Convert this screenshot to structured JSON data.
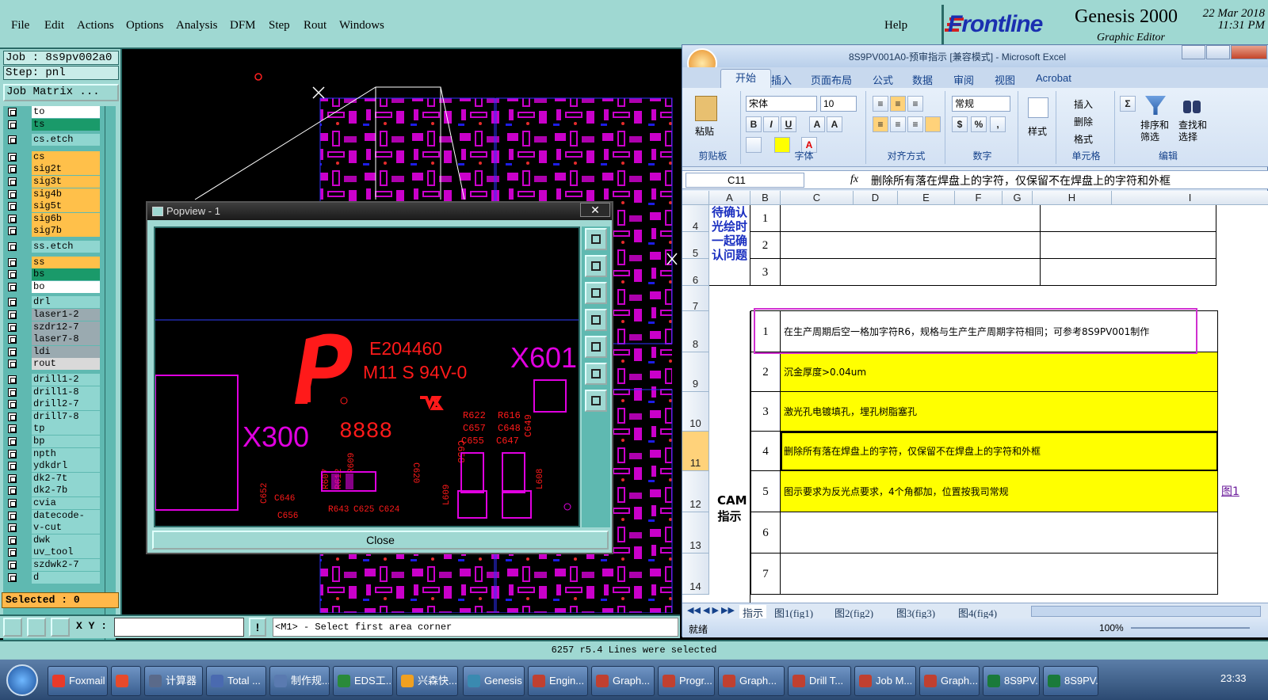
{
  "genesis": {
    "menus": [
      "File",
      "Edit",
      "Actions",
      "Options",
      "Analysis",
      "DFM",
      "Step",
      "Rout",
      "Windows"
    ],
    "help": "Help",
    "brand": "Frontline",
    "product": "Genesis 2000",
    "subtitle": "Graphic Editor",
    "date": "22 Mar 2018",
    "time": "11:31 PM",
    "job": "Job : 8s9pv002a0",
    "step": "Step: pnl",
    "job_matrix": "Job Matrix ...",
    "layers": [
      {
        "name": "to",
        "color": "#ffffff"
      },
      {
        "name": "ts",
        "color": "#1a9a6a"
      },
      {
        "name": "cs.etch",
        "color": "#8fd6d0"
      },
      {
        "name": "cs",
        "color": "#ffc04a"
      },
      {
        "name": "sig2t",
        "color": "#ffc04a"
      },
      {
        "name": "sig3t",
        "color": "#ffc04a"
      },
      {
        "name": "sig4b",
        "color": "#ffc04a"
      },
      {
        "name": "sig5t",
        "color": "#ffc04a"
      },
      {
        "name": "sig6b",
        "color": "#ffc04a"
      },
      {
        "name": "sig7b",
        "color": "#ffc04a"
      },
      {
        "name": "ss.etch",
        "color": "#8fd6d0"
      },
      {
        "name": "ss",
        "color": "#ffc04a"
      },
      {
        "name": "bs",
        "color": "#1a9a6a"
      },
      {
        "name": "bo",
        "color": "#ffffff"
      },
      {
        "name": "drl",
        "color": "#8fd6d0"
      },
      {
        "name": "laser1-2",
        "color": "#9aaab0"
      },
      {
        "name": "szdr12-7",
        "color": "#9aaab0"
      },
      {
        "name": "laser7-8",
        "color": "#9aaab0"
      },
      {
        "name": "ldi",
        "color": "#9aaab0"
      },
      {
        "name": "rout",
        "color": "#d9d9d9"
      },
      {
        "name": "drill1-2",
        "color": "#8fd6d0"
      },
      {
        "name": "drill1-8",
        "color": "#8fd6d0"
      },
      {
        "name": "drill2-7",
        "color": "#8fd6d0"
      },
      {
        "name": "drill7-8",
        "color": "#8fd6d0"
      },
      {
        "name": "tp",
        "color": "#8fd6d0"
      },
      {
        "name": "bp",
        "color": "#8fd6d0"
      },
      {
        "name": "npth",
        "color": "#8fd6d0"
      },
      {
        "name": "ydkdrl",
        "color": "#8fd6d0"
      },
      {
        "name": "dk2-7t",
        "color": "#8fd6d0"
      },
      {
        "name": "dk2-7b",
        "color": "#8fd6d0"
      },
      {
        "name": "cvia",
        "color": "#8fd6d0"
      },
      {
        "name": "datecode-pte",
        "color": "#8fd6d0"
      },
      {
        "name": "v-cut",
        "color": "#8fd6d0"
      },
      {
        "name": "dwk",
        "color": "#8fd6d0"
      },
      {
        "name": "uv_tool",
        "color": "#8fd6d0"
      },
      {
        "name": "szdwk2-7",
        "color": "#8fd6d0"
      },
      {
        "name": "d",
        "color": "#8fd6d0"
      }
    ],
    "selected": "Selected : 0",
    "xy_label": "X Y :",
    "xy_value": "",
    "prompt": "<M1> - Select first area corner",
    "status": "6257 r5.4 Lines were selected"
  },
  "popview": {
    "title": "Popview - 1",
    "close": "Close",
    "board_texts": [
      "E204460",
      "M11 S 94V-0",
      "X601",
      "X300",
      "8888",
      "R622",
      "C657",
      "C655",
      "R616",
      "C648",
      "C647",
      "C649",
      "C658",
      "R607",
      "R612",
      "R609",
      "C620",
      "C652",
      "C646",
      "C656",
      "R643",
      "C625",
      "C624",
      "L609",
      "L608"
    ]
  },
  "excel": {
    "title": "8S9PV001A0-预审指示 [兼容模式] - Microsoft Excel",
    "tabs": [
      "开始",
      "插入",
      "页面布局",
      "公式",
      "数据",
      "审阅",
      "视图",
      "Acrobat"
    ],
    "groups": [
      "剪贴板",
      "字体",
      "对齐方式",
      "数字",
      "样式",
      "单元格",
      "编辑"
    ],
    "paste": "粘贴",
    "font_name": "宋体",
    "font_size": "10",
    "number_format": "常规",
    "insert": "插入",
    "delete": "删除",
    "format": "格式",
    "sort": "排序和\n筛选",
    "find": "查找和\n选择",
    "style_btn": "样式",
    "name_box": "C11",
    "formula": "删除所有落在焊盘上的字符，仅保留不在焊盘上的字符和外框",
    "columns": [
      "A",
      "B",
      "C",
      "D",
      "E",
      "F",
      "G",
      "H",
      "I"
    ],
    "rows": [
      "4",
      "5",
      "6",
      "7",
      "8",
      "9",
      "10",
      "11",
      "12",
      "13",
      "14"
    ],
    "confirm_label": "待确认光绘时一起确认问题",
    "cam_label": "CAM指示",
    "confirm_items": [
      "1",
      "2",
      "3"
    ],
    "instructions": [
      {
        "no": "1",
        "text": "在生产周期后空一格加字符R6，规格与生产生产周期字符相同；可参考8S9PV001制作"
      },
      {
        "no": "2",
        "text": "沉金厚度>0.04um"
      },
      {
        "no": "3",
        "text": "激光孔电镀填孔，埋孔树脂塞孔"
      },
      {
        "no": "4",
        "text": "删除所有落在焊盘上的字符，仅保留不在焊盘上的字符和外框"
      },
      {
        "no": "5",
        "text": "图示要求为反光点要求，4个角都加，位置按我司常规"
      },
      {
        "no": "6",
        "text": ""
      },
      {
        "no": "7",
        "text": ""
      }
    ],
    "link_text": "图1",
    "sheet_tabs": [
      "指示",
      "图1(fig1)",
      "图2(fig2)",
      "图3(fig3)",
      "图4(fig4)"
    ],
    "status_ready": "就绪",
    "zoom": "100%"
  },
  "taskbar": {
    "items": [
      "Foxmail",
      "",
      "计算器",
      "Total ...",
      "制作规...",
      "EDS工...",
      "兴森快...",
      "Genesis",
      "Engin...",
      "Graph...",
      "Progr...",
      "Graph...",
      "Drill T...",
      "Job M...",
      "Graph...",
      "8S9PV...",
      "8S9PV..."
    ],
    "clock": "23:33"
  },
  "colors": {
    "accent": "#9fd8d2",
    "highlight": "#ffff00",
    "silk": "#ff1a1a",
    "copper": "#e000e0"
  }
}
